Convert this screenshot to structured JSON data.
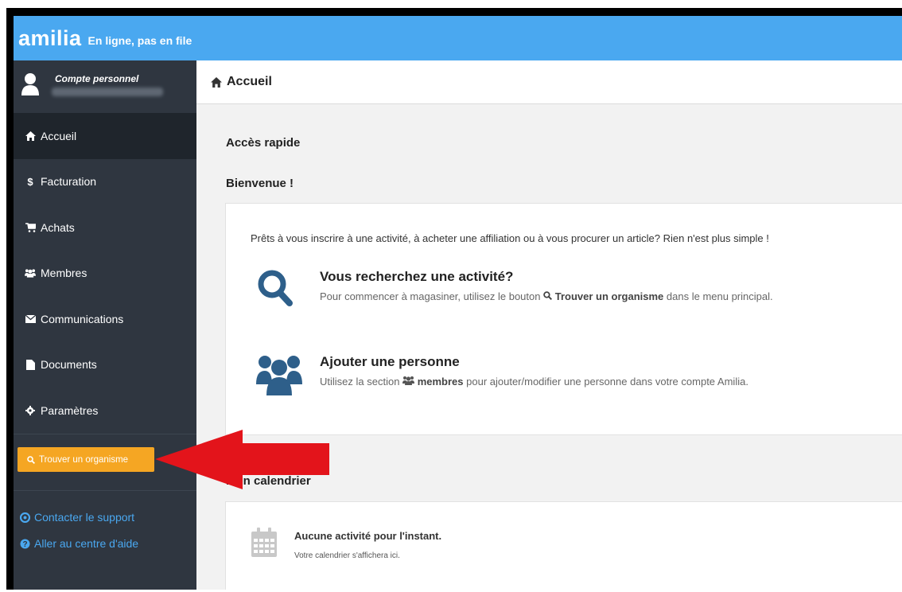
{
  "header": {
    "logo": "amilia",
    "tagline": "En ligne, pas en file"
  },
  "sidebar": {
    "account_title": "Compte personnel",
    "items": [
      {
        "label": "Accueil",
        "icon": "home-icon"
      },
      {
        "label": "Facturation",
        "icon": "dollar-icon"
      },
      {
        "label": "Achats",
        "icon": "cart-icon"
      },
      {
        "label": "Membres",
        "icon": "users-icon"
      },
      {
        "label": "Communications",
        "icon": "envelope-icon"
      },
      {
        "label": "Documents",
        "icon": "file-icon"
      },
      {
        "label": "Paramètres",
        "icon": "gear-icon"
      }
    ],
    "find_button": "Trouver un organisme",
    "links": [
      {
        "label": "Contacter le support",
        "icon": "lifebuoy-icon"
      },
      {
        "label": "Aller au centre d'aide",
        "icon": "question-icon"
      }
    ]
  },
  "main": {
    "page_title": "Accueil",
    "quick_access": "Accès rapide",
    "welcome": "Bienvenue !",
    "intro": "Prêts à vous inscrire à une activité, à acheter une affiliation ou à vous procurer un article? Rien n'est plus simple !",
    "feature_search": {
      "title": "Vous recherchez une activité?",
      "desc_pre": "Pour commencer à magasiner, utilisez le bouton",
      "desc_bold": "Trouver un organisme",
      "desc_post": "dans le menu principal."
    },
    "feature_person": {
      "title": "Ajouter une personne",
      "desc_pre": "Utilisez la section",
      "desc_bold": "membres",
      "desc_post": "pour ajouter/modifier une personne dans votre compte Amilia."
    },
    "calendar_title": "Mon calendrier",
    "calendar_empty_title": "Aucune activité pour l'instant.",
    "calendar_empty_sub": "Votre calendrier s'affichera ici."
  },
  "colors": {
    "topbar": "#4aa8f0",
    "sidebar": "#2f3640",
    "accent_button": "#f5a623",
    "icon_blue": "#2e5f8a",
    "annotation_arrow": "#e3141b"
  }
}
